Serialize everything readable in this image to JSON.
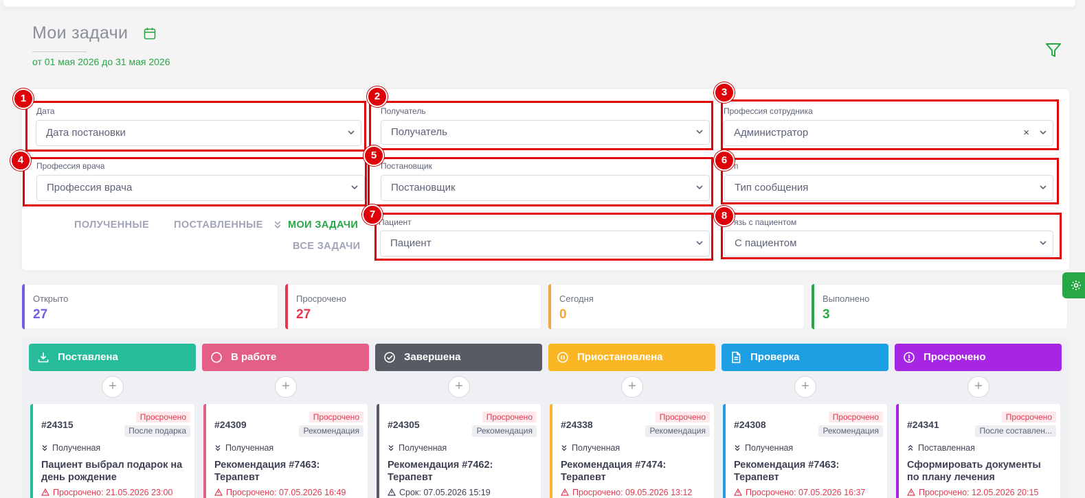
{
  "header": {
    "title": "Мои задачи",
    "date_range": "от 01 мая 2026 до 31 мая 2026"
  },
  "filters": [
    {
      "badge": "1",
      "label": "Дата",
      "value": "Дата постановки",
      "clearable": false
    },
    {
      "badge": "2",
      "label": "Получатель",
      "value": "Получатель",
      "clearable": false
    },
    {
      "badge": "3",
      "label": "Профессия сотрудника",
      "value": "Администратор",
      "clearable": true,
      "clear_glyph": "×"
    },
    {
      "badge": "4",
      "label": "Профессия врача",
      "value": "Профессия врача",
      "clearable": false
    },
    {
      "badge": "5",
      "label": "Постановщик",
      "value": "Постановщик",
      "clearable": false
    },
    {
      "badge": "6",
      "label": "п",
      "value": "Тип сообщения",
      "clearable": false
    },
    {
      "badge": "7",
      "label": "Пациент",
      "value": "Пациент",
      "clearable": false
    },
    {
      "badge": "8",
      "label": "язь с пациентом",
      "value": "С пациентом",
      "clearable": false
    }
  ],
  "tabs": {
    "received": "ПОЛУЧЕННЫЕ",
    "assigned": "ПОСТАВЛЕННЫЕ",
    "mine": "МОИ ЗАДАЧИ",
    "all": "ВСЕ ЗАДАЧИ",
    "active": "mine"
  },
  "stats": [
    {
      "label": "Открыто",
      "value": "27",
      "color": "#6f5ee8"
    },
    {
      "label": "Просрочено",
      "value": "27",
      "color": "#e5384f"
    },
    {
      "label": "Сегодня",
      "value": "0",
      "color": "#f6a63b"
    },
    {
      "label": "Выполнено",
      "value": "3",
      "color": "#28a745"
    }
  ],
  "columns": [
    {
      "title": "Поставлена",
      "icon": "download-icon",
      "color": "#27bd9a",
      "card": {
        "number": "#24315",
        "status": "Просрочено",
        "type": "После подарка",
        "direction": "Полученная",
        "direction_icon": "chevron-double-down-icon",
        "title": "Пациент выбрал подарок на день рождение",
        "due": "Просрочено: 21.05.2026 23:00",
        "due_color": "#e5384f"
      }
    },
    {
      "title": "В работе",
      "icon": "circle-icon",
      "color": "#e45f86",
      "card": {
        "number": "#24309",
        "status": "Просрочено",
        "type": "Рекомендация",
        "direction": "Полученная",
        "direction_icon": "chevron-double-down-icon",
        "title": "Рекомендация #7463: Терапевт",
        "due": "Просрочено: 07.05.2026 16:49",
        "due_color": "#e5384f"
      }
    },
    {
      "title": "Завершена",
      "icon": "check-circle-icon",
      "color": "#575b63",
      "card": {
        "number": "#24305",
        "status": "Просрочено",
        "type": "Рекомендация",
        "direction": "Полученная",
        "direction_icon": "chevron-double-down-icon",
        "title": "Рекомендация #7462: Терапевт",
        "due": "Срок: 07.05.2026 15:19",
        "due_color": "#3f4254"
      }
    },
    {
      "title": "Приостановлена",
      "icon": "pause-circle-icon",
      "color": "#fbb625",
      "card": {
        "number": "#24338",
        "status": "Просрочено",
        "type": "Рекомендация",
        "direction": "Полученная",
        "direction_icon": "chevron-double-down-icon",
        "title": "Рекомендация #7474: Терапевт",
        "due": "Просрочено: 09.05.2026 13:12",
        "due_color": "#e5384f"
      }
    },
    {
      "title": "Проверка",
      "icon": "document-icon",
      "color": "#1e9fe3",
      "card": {
        "number": "#24308",
        "status": "Просрочено",
        "type": "Рекомендация",
        "direction": "Полученная",
        "direction_icon": "chevron-double-down-icon",
        "title": "Рекомендация #7463: Терапевт",
        "due": "Просрочено: 07.05.2026 16:37",
        "due_color": "#e5384f"
      }
    },
    {
      "title": "Просрочено",
      "icon": "alert-circle-icon",
      "color": "#a626e4",
      "card": {
        "number": "#24341",
        "status": "Просрочено",
        "type": "После составлен...",
        "direction": "Поставленная",
        "direction_icon": "chevron-double-up-icon",
        "title": "Сформировать документы по плану лечения",
        "due": "Просрочено: 12.05.2026 20:15",
        "due_color": "#e5384f"
      }
    }
  ],
  "colors": {
    "accent": "#28a745",
    "highlight": "#e0000a"
  }
}
